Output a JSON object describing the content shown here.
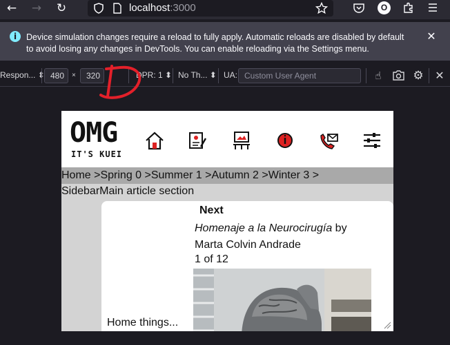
{
  "browser": {
    "url_host": "localhost",
    "url_port": ":3000",
    "profile_initial": "O"
  },
  "notice": {
    "text": "Device simulation changes require a reload to fully apply. Automatic reloads are disabled by default to avoid losing any changes in DevTools. You can enable reloading via the Settings menu."
  },
  "rdm": {
    "device": "Respon...",
    "width": "480",
    "times": "×",
    "height": "320",
    "dpr": "DPR: 1",
    "throttle": "No Th...",
    "ua_label": "UA:",
    "ua_placeholder": "Custom User Agent"
  },
  "annotation": {
    "letter": "D",
    "color": "#e3202a"
  },
  "page": {
    "logo_main": "OMG",
    "logo_sub": "IT'S KUEI",
    "nav_icons": [
      "home-icon",
      "write-icon",
      "gallery-icon",
      "info-icon",
      "phone-mail-icon",
      "sliders-icon"
    ],
    "breadcrumb": "Home >Spring 0 >Summer 1 >Autumn 2 >Winter 3 >",
    "section_title": "SidebarMain article section",
    "next_label": "Next",
    "article_title_italic": "Homenaje a la Neurocirugía",
    "article_by": " by",
    "article_author": "Marta Colvin Andrade",
    "counter": "1 of 12",
    "home_things": "Home things..."
  }
}
